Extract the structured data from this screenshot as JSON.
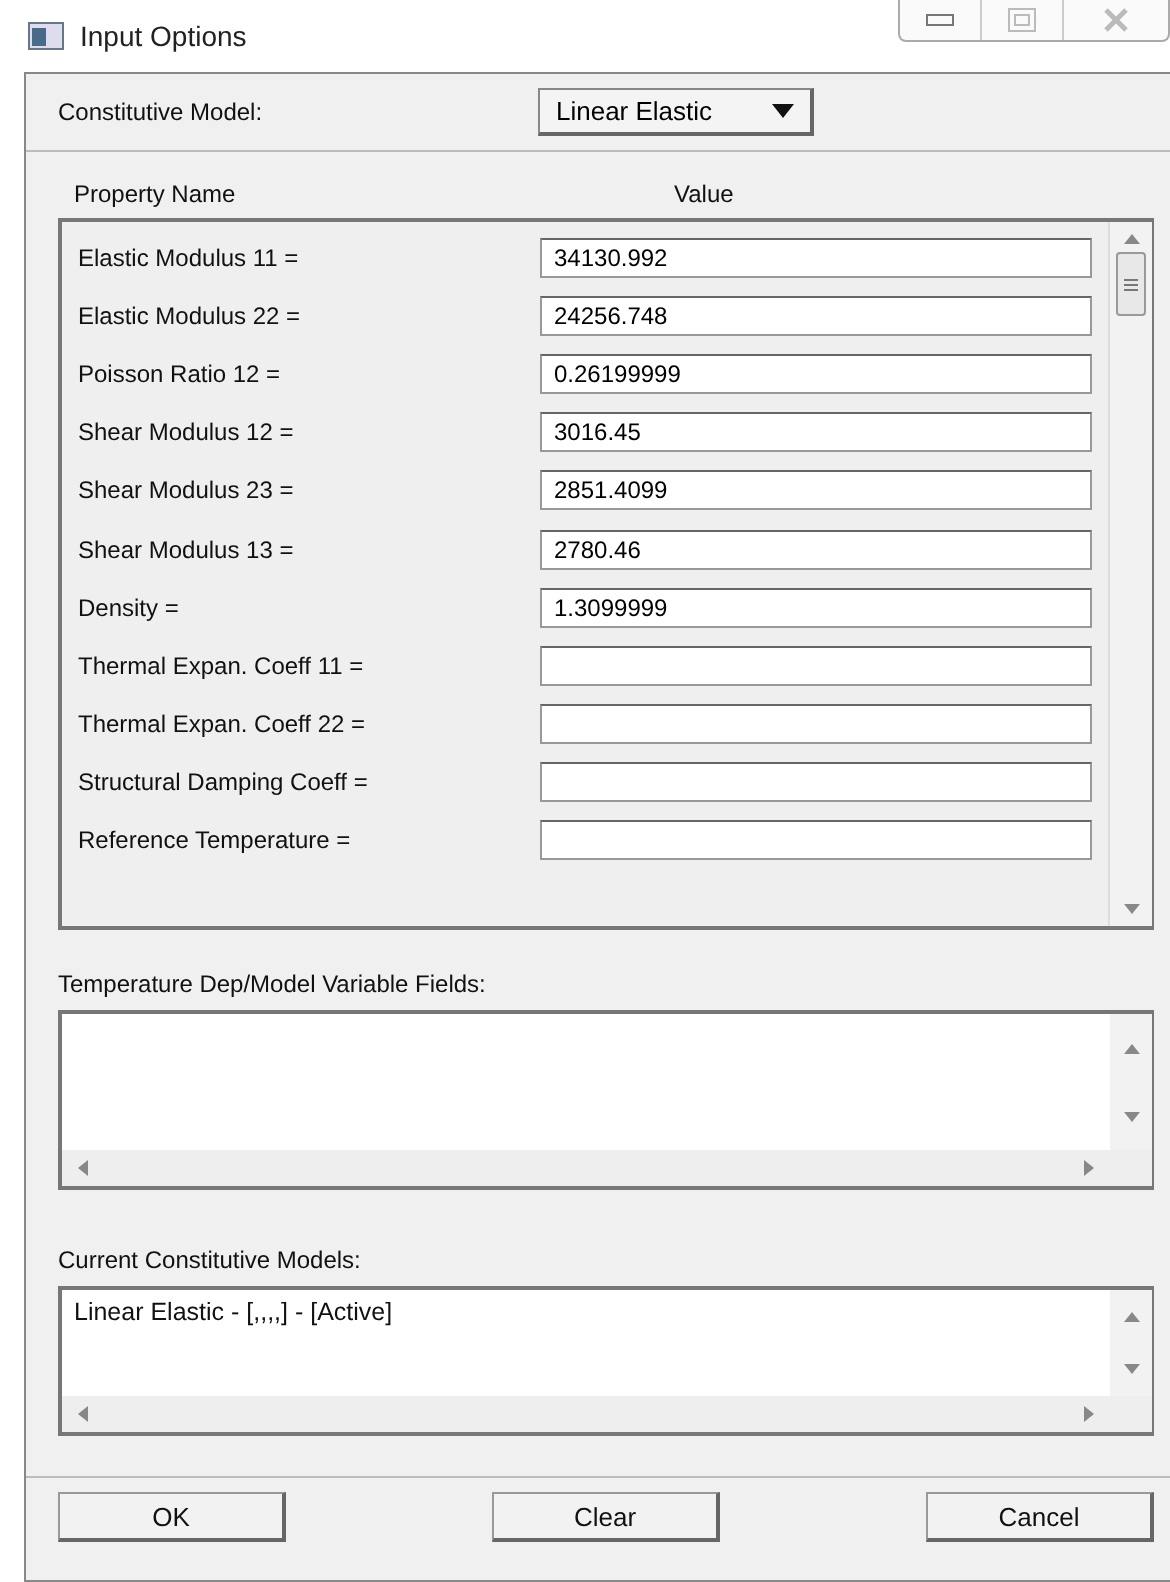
{
  "window": {
    "title": "Input Options"
  },
  "constitutive_model": {
    "label": "Constitutive Model:",
    "value": "Linear Elastic"
  },
  "properties": {
    "columns": [
      "Property Name",
      "Value"
    ],
    "rows": [
      {
        "name": "Elastic Modulus 11 =",
        "value": "34130.992"
      },
      {
        "name": "Elastic Modulus 22 =",
        "value": "24256.748"
      },
      {
        "name": "Poisson Ratio 12 =",
        "value": "0.26199999"
      },
      {
        "name": "Shear Modulus 12 =",
        "value": "3016.45"
      },
      {
        "name": "Shear Modulus 23 =",
        "value": "2851.4099"
      },
      {
        "name": "Shear Modulus 13 =",
        "value": "2780.46"
      },
      {
        "name": "Density =",
        "value": "1.3099999"
      },
      {
        "name": "Thermal Expan. Coeff 11 ="
      },
      {
        "name": "Thermal Expan. Coeff 22 ="
      },
      {
        "name": "Structural Damping Coeff ="
      },
      {
        "name": "Reference Temperature ="
      }
    ]
  },
  "variable_fields": {
    "label": "Temperature Dep/Model Variable Fields:"
  },
  "current_models": {
    "label": "Current Constitutive Models:",
    "items": [
      "Linear Elastic - [,,,,] - [Active]"
    ]
  },
  "buttons": [
    "OK",
    "Clear",
    "Cancel"
  ]
}
